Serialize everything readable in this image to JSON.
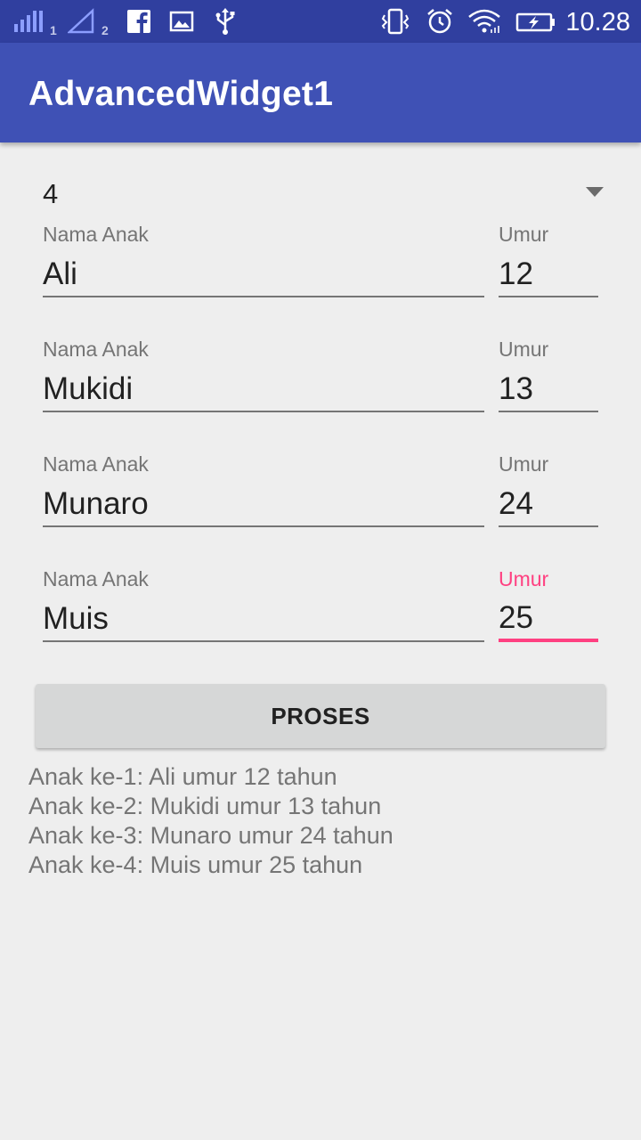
{
  "status_bar": {
    "time": "10.28",
    "sim1_label": "1",
    "sim2_label": "2",
    "icons": [
      "signal-icon",
      "signal-icon",
      "facebook-icon",
      "image-icon",
      "usb-icon",
      "vibrate-icon",
      "alarm-icon",
      "wifi-icon",
      "battery-charging-icon"
    ],
    "bar_color": "#303f9f"
  },
  "app_bar": {
    "title": "AdvancedWidget1",
    "color": "#3f51b5"
  },
  "spinner": {
    "selected": "4"
  },
  "rows": [
    {
      "name_label": "Nama Anak",
      "name_value": "Ali",
      "age_label": "Umur",
      "age_value": "12"
    },
    {
      "name_label": "Nama Anak",
      "name_value": "Mukidi",
      "age_label": "Umur",
      "age_value": "13"
    },
    {
      "name_label": "Nama Anak",
      "name_value": "Munaro",
      "age_label": "Umur",
      "age_value": "24"
    },
    {
      "name_label": "Nama Anak",
      "name_value": "Muis",
      "age_label": "Umur",
      "age_value": "25"
    }
  ],
  "button": {
    "label": "PROSES"
  },
  "result": [
    "Anak ke-1: Ali umur 12 tahun",
    "Anak ke-2: Mukidi umur 13 tahun",
    "Anak ke-3: Munaro umur 24 tahun",
    "Anak ke-4: Muis umur 25 tahun"
  ],
  "accent_color": "#ff4081"
}
